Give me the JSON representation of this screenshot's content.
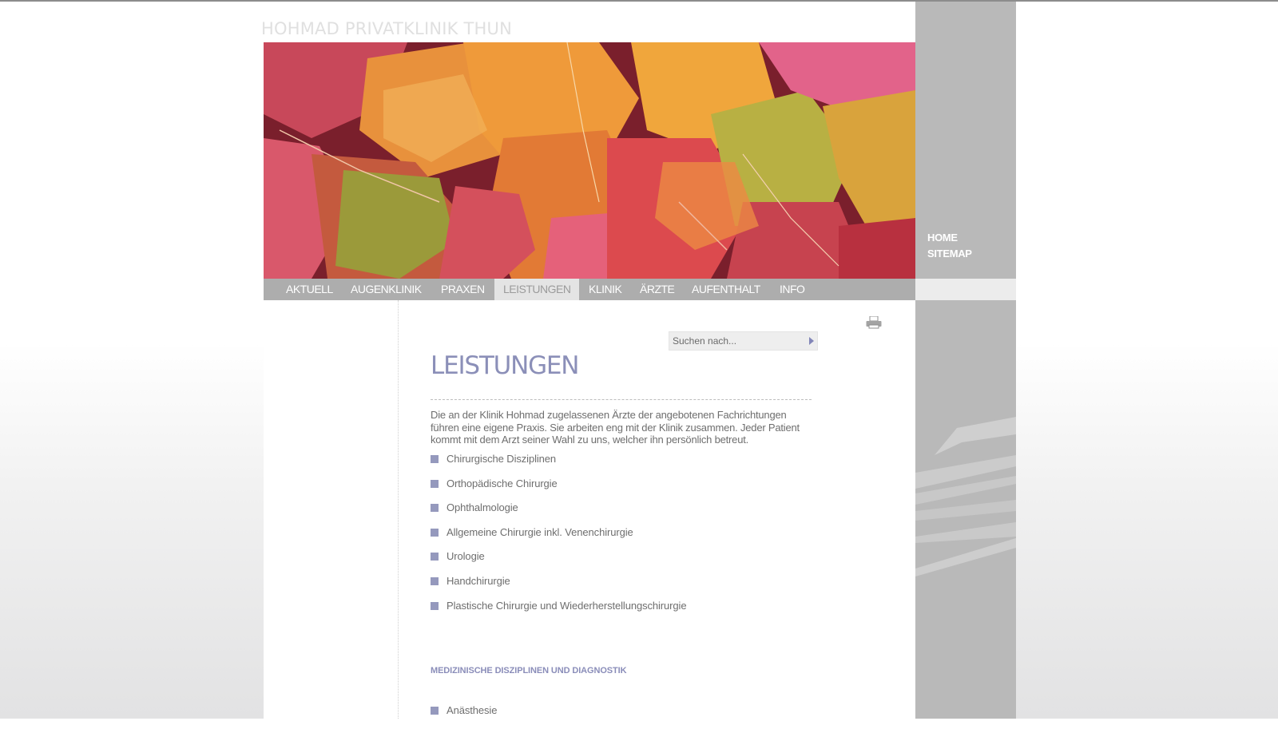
{
  "site": {
    "title": "HOHMAD PRIVATKLINIK THUN"
  },
  "nav": {
    "items": [
      {
        "label": "AKTUELL"
      },
      {
        "label": "AUGENKLINIK"
      },
      {
        "label": "PRAXEN"
      },
      {
        "label": "LEISTUNGEN",
        "active": true
      },
      {
        "label": "KLINIK"
      },
      {
        "label": "ÄRZTE"
      },
      {
        "label": "AUFENTHALT"
      },
      {
        "label": "INFO"
      }
    ]
  },
  "side_nav": {
    "home": "HOME",
    "sitemap": "SITEMAP"
  },
  "search": {
    "placeholder": "Suchen nach..."
  },
  "content": {
    "heading": "LEISTUNGEN",
    "intro": "Die an der Klinik Hohmad zugelassenen Ärzte der angebotenen Fachrichtungen führen eine eigene Praxis. Sie arbeiten eng mit der Klinik zusammen. Jeder Patient kommt mit dem Arzt seiner Wahl zu uns, welcher ihn persönlich betreut.",
    "services": [
      "Chirurgische Disziplinen",
      "Orthopädische Chirurgie",
      "Ophthalmologie",
      "Allgemeine Chirurgie inkl. Venenchirurgie",
      "Urologie",
      "Handchirurgie",
      "Plastische Chirurgie und Wiederherstellungschirurgie"
    ],
    "section2": {
      "heading": "MEDIZINISCHE DISZIPLINEN UND DIAGNOSTIK",
      "items": [
        "Anästhesie"
      ]
    }
  },
  "icons": {
    "print": "printer-icon",
    "search_submit": "arrow-right-icon",
    "bullet": "square-bullet-icon"
  },
  "colors": {
    "accent": "#8b8fb8",
    "nav_bg": "#adadad",
    "nav_active_bg": "#e4e4e4",
    "side_column": "#b9b9b9",
    "bullet": "#9599bd",
    "text": "#6e6e6e"
  }
}
